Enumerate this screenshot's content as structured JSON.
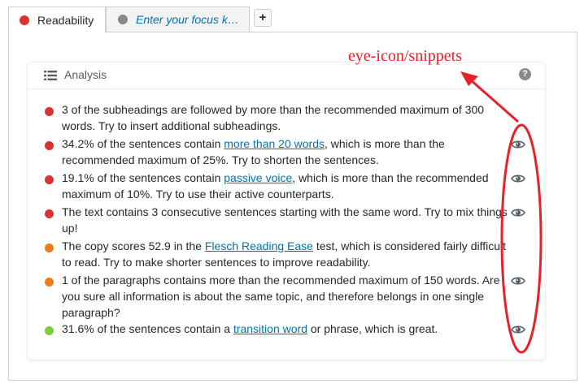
{
  "tabs": [
    {
      "label": "Readability",
      "dot_color": "#dc3232",
      "active": true
    },
    {
      "label": "Enter your focus k…",
      "dot_color": "#888888",
      "active": false
    }
  ],
  "add_tab_label": "+",
  "analysis": {
    "title": "Analysis",
    "help_symbol": "?"
  },
  "results": [
    {
      "status_color": "#dc3232",
      "parts": [
        "3 of the subheadings are followed by more than the recommended maximum of 300 words. Try to insert additional subheadings."
      ],
      "has_eye": false
    },
    {
      "status_color": "#dc3232",
      "before": "34.2% of the sentences contain ",
      "link": "more than 20 words",
      "after": ", which is more than the recommended maximum of 25%. Try to shorten the sentences.",
      "has_eye": true
    },
    {
      "status_color": "#dc3232",
      "before": "19.1% of the sentences contain ",
      "link": "passive voice",
      "after": ", which is more than the recommended maximum of 10%. Try to use their active counterparts.",
      "has_eye": true
    },
    {
      "status_color": "#dc3232",
      "before": "The text contains 3 consecutive sentences starting with the same word. Try to mix things up!",
      "has_eye": true
    },
    {
      "status_color": "#ee7c1b",
      "before": "The copy scores 52.9 in the ",
      "link": "Flesch Reading Ease",
      "after": " test, which is considered fairly difficult to read. Try to make shorter sentences to improve readability.",
      "has_eye": false
    },
    {
      "status_color": "#ee7c1b",
      "before": "1 of the paragraphs contains more than the recommended maximum of 150 words. Are you sure all information is about the same topic, and therefore belongs in one single paragraph?",
      "has_eye": true
    },
    {
      "status_color": "#7ad03a",
      "before": "31.6% of the sentences contain a ",
      "link": "transition word",
      "after": " or phrase, which is great.",
      "has_eye": true
    }
  ],
  "annotation": {
    "label": "eye-icon/snippets",
    "color": "#e8202a"
  }
}
